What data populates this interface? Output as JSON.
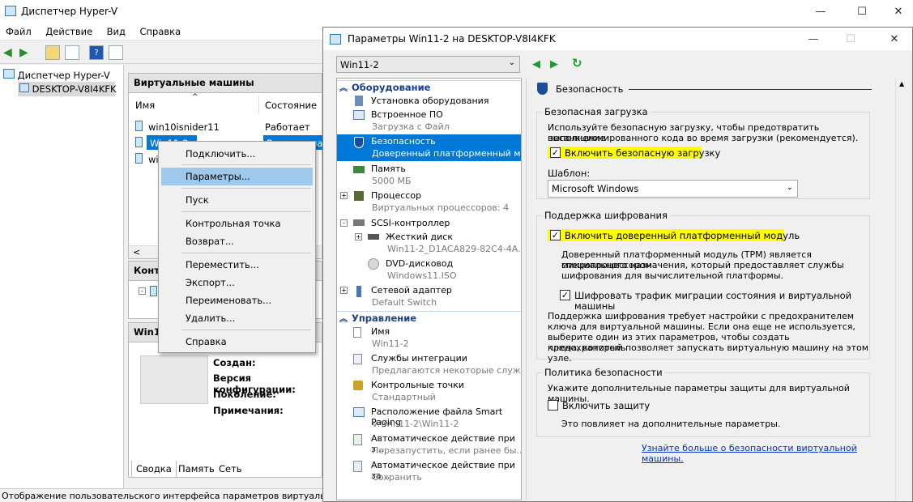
{
  "main": {
    "title": "Диспетчер Hyper-V",
    "menu": [
      "Файл",
      "Действие",
      "Вид",
      "Справка"
    ],
    "tree": {
      "root": "Диспетчер Hyper-V",
      "host": "DESKTOP-V8I4KFK"
    },
    "vm_panel": {
      "title": "Виртуальные машины",
      "col_name": "Имя",
      "col_state": "Состояние",
      "rows": [
        {
          "name": "win10isnider11",
          "state": "Работает"
        },
        {
          "name": "Win11-2",
          "state": "Выключена"
        },
        {
          "name": "wi",
          "state": ""
        }
      ]
    },
    "checkpoint_panel_title": "Контр",
    "details_panel": {
      "title": "Win1",
      "labels": [
        "Создан:",
        "Версия конфигурации:",
        "Поколение:",
        "Примечания:"
      ],
      "tabs": [
        "Сводка",
        "Память",
        "Сеть"
      ]
    },
    "status": "Отображение пользовательского интерфейса параметров виртуальной"
  },
  "context_menu": {
    "items": [
      "Подключить...",
      "Параметры...",
      "Пуск",
      "Контрольная точка",
      "Возврат...",
      "Переместить...",
      "Экспорт...",
      "Переименовать...",
      "Удалить...",
      "Справка"
    ]
  },
  "dialog": {
    "title": "Параметры Win11-2 на DESKTOP-V8I4KFK",
    "vm_select": "Win11-2",
    "sections": {
      "hardware": "Оборудование",
      "management": "Управление"
    },
    "hardware_items": [
      {
        "name": "Установка оборудования",
        "sub": ""
      },
      {
        "name": "Встроенное ПО",
        "sub": "Загрузка с Файл"
      },
      {
        "name": "Безопасность",
        "sub": "Доверенный платформенный мо..."
      },
      {
        "name": "Память",
        "sub": "5000 МБ"
      },
      {
        "name": "Процессор",
        "sub": "Виртуальных процессоров: 4"
      },
      {
        "name": "SCSI-контроллер",
        "sub": ""
      },
      {
        "name": "Жесткий диск",
        "sub": "Win11-2_D1ACA829-82C4-4A..."
      },
      {
        "name": "DVD-дисковод",
        "sub": "Windows11.ISO"
      },
      {
        "name": "Сетевой адаптер",
        "sub": "Default Switch"
      }
    ],
    "management_items": [
      {
        "name": "Имя",
        "sub": "Win11-2"
      },
      {
        "name": "Службы интеграции",
        "sub": "Предлагаются некоторые службы"
      },
      {
        "name": "Контрольные точки",
        "sub": "Стандартный"
      },
      {
        "name": "Расположение файла Smart Paging",
        "sub": "V:\\win11-2\\Win11-2"
      },
      {
        "name": "Автоматическое действие при з...",
        "sub": "Перезапустить, если ранее бы..."
      },
      {
        "name": "Автоматическое действие при за...",
        "sub": "Сохранить"
      }
    ],
    "right": {
      "heading": "Безопасность",
      "secure_boot": {
        "title": "Безопасная загрузка",
        "desc_1": "Используйте безопасную загрузку, чтобы предотвратить выполнение",
        "desc_2": "несанкционированного кода во время загрузки (рекомендуется).",
        "checkbox": "Включить безопасную загрузку",
        "template_label": "Шаблон:",
        "template_value": "Microsoft Windows"
      },
      "encryption": {
        "title": "Поддержка шифрования",
        "tpm_checkbox": "Включить доверенный платформенный модуль",
        "tpm_desc_1": "Доверенный платформенный модуль (TPM) является микропроцессором",
        "tpm_desc_2": "специального назначения, который предоставляет службы",
        "tpm_desc_3": "шифрования для вычислительной платформы.",
        "migration_checkbox": "Шифровать трафик миграции состояния и виртуальной машины",
        "note_1": "Поддержка шифрования требует настройки с предохранителем",
        "note_2": "ключа для виртуальной машины. Если она еще не используется,",
        "note_3": "выберите один из этих параметров, чтобы создать предохранитель",
        "note_4": "ключа, который позволяет запускать виртуальную машину на этом узле."
      },
      "policy": {
        "title": "Политика безопасности",
        "desc": "Укажите дополнительные параметры защиты для виртуальной машины.",
        "checkbox": "Включить защиту",
        "note": "Это повлияет на дополнительные параметры."
      },
      "link": "Узнайте больше о безопасности виртуальной машины."
    }
  },
  "icons": {
    "check": "✓",
    "minimize": "—",
    "maximize": "☐",
    "close": "✕",
    "back": "◀",
    "forward": "▶",
    "refresh": "↻",
    "collapse": "︽"
  }
}
